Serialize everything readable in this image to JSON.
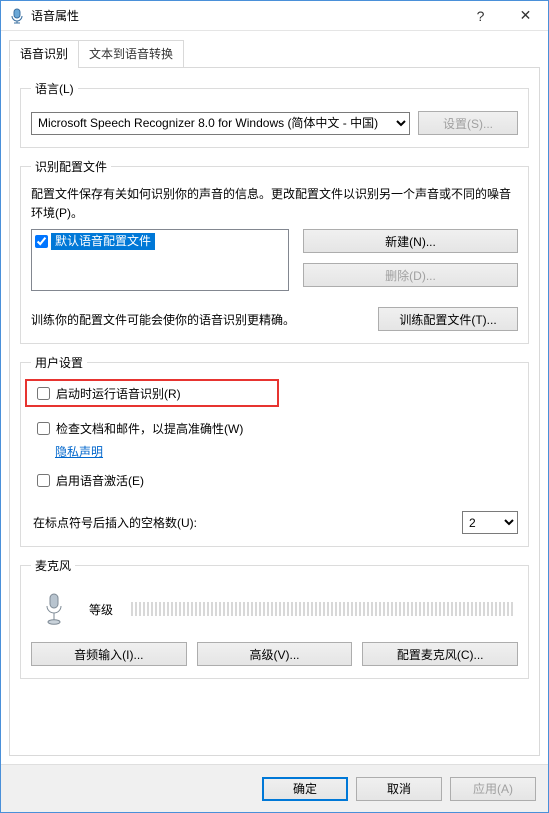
{
  "window": {
    "title": "语音属性",
    "help_tooltip": "?",
    "close_tooltip": "✕"
  },
  "tabs": {
    "recognition": "语音识别",
    "tts": "文本到语音转换"
  },
  "language_group": {
    "legend": "语言(L)",
    "selected": "Microsoft Speech Recognizer 8.0 for Windows (简体中文 - 中国)",
    "settings_btn": "设置(S)..."
  },
  "profiles_group": {
    "legend": "识别配置文件",
    "description": "配置文件保存有关如何识别你的声音的信息。更改配置文件以识别另一个声音或不同的噪音环境(P)。",
    "new_btn": "新建(N)...",
    "delete_btn": "删除(D)...",
    "default_profile": "默认语音配置文件",
    "train_hint": "训练你的配置文件可能会使你的语音识别更精确。",
    "train_btn": "训练配置文件(T)..."
  },
  "user_settings_group": {
    "legend": "用户设置",
    "run_at_startup": "启动时运行语音识别(R)",
    "review_docs": "检查文档和邮件，以提高准确性(W)",
    "privacy_link": "隐私声明",
    "enable_voice_activate": "启用语音激活(E)",
    "spaces_after_punct_label": "在标点符号后插入的空格数(U):",
    "spaces_value": "2"
  },
  "mic_group": {
    "legend": "麦克风",
    "level_label": "等级",
    "audio_input_btn": "音频输入(I)...",
    "advanced_btn": "高级(V)...",
    "config_mic_btn": "配置麦克风(C)..."
  },
  "footer": {
    "ok": "确定",
    "cancel": "取消",
    "apply": "应用(A)"
  }
}
